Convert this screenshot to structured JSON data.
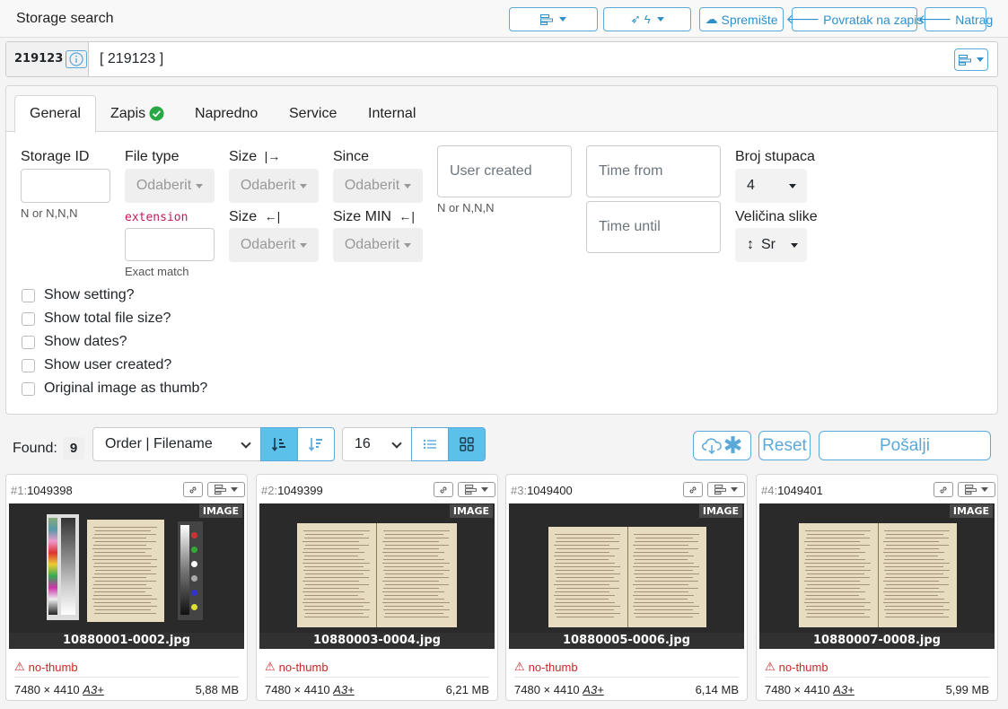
{
  "header": {
    "title": "Storage search",
    "buttons": {
      "storage": "Spremište",
      "back_to_record": "Povratak na zapis",
      "back": "Natrag"
    }
  },
  "idbar": {
    "id": "219123",
    "value": "[ 219123 ]"
  },
  "tabs": [
    "General",
    "Zapis",
    "Napredno",
    "Service",
    "Internal"
  ],
  "form": {
    "storage_id": "Storage ID",
    "storage_id_hint": "N or N,N,N",
    "file_type": "File type",
    "extension": "extension",
    "exact_match": "Exact match",
    "size_from": "Size",
    "size_to": "Size",
    "since": "Since",
    "size_min": "Size MIN",
    "dropdown_placeholder": "Odaberit",
    "user_created_placeholder": "User created",
    "user_created_hint": "N or N,N,N",
    "time_from_placeholder": "Time from",
    "time_until_placeholder": "Time until",
    "columns_label": "Broj stupaca",
    "columns_value": "4",
    "image_size_label": "Veličina slike",
    "image_size_value": "Sr",
    "checkboxes": [
      "Show setting?",
      "Show total file size?",
      "Show dates?",
      "Show user created?",
      "Original image as thumb?"
    ]
  },
  "toolbar": {
    "found_label": "Found:",
    "found_count": "9",
    "order_value": "Order | Filename",
    "per_page": "16",
    "reset": "Reset",
    "send": "Pošalji"
  },
  "cards": [
    {
      "index": "#1:",
      "id": "1049398",
      "tag": "IMAGE",
      "filename": "10880001-0002.jpg",
      "warning": "no-thumb",
      "dims": "7480 × 4410",
      "format": "A3+",
      "size": "5,88 MB"
    },
    {
      "index": "#2:",
      "id": "1049399",
      "tag": "IMAGE",
      "filename": "10880003-0004.jpg",
      "warning": "no-thumb",
      "dims": "7480 × 4410",
      "format": "A3+",
      "size": "6,21 MB"
    },
    {
      "index": "#3:",
      "id": "1049400",
      "tag": "IMAGE",
      "filename": "10880005-0006.jpg",
      "warning": "no-thumb",
      "dims": "7480 × 4410",
      "format": "A3+",
      "size": "6,14 MB"
    },
    {
      "index": "#4:",
      "id": "1049401",
      "tag": "IMAGE",
      "filename": "10880007-0008.jpg",
      "warning": "no-thumb",
      "dims": "7480 × 4410",
      "format": "A3+",
      "size": "5,99 MB"
    }
  ],
  "colors": {
    "accent": "#5aa9d8",
    "active_button": "#5bc0ea",
    "warning": "#c62828",
    "success": "#28a745"
  }
}
